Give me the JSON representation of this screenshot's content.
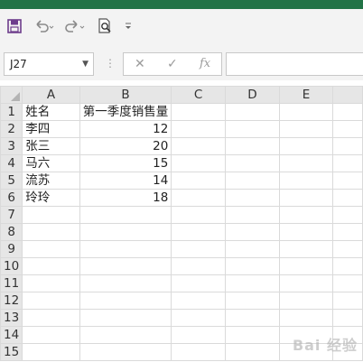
{
  "app": {
    "accent": "#217346"
  },
  "toolbar": {
    "icons": [
      "save-icon",
      "undo-icon",
      "redo-icon",
      "print-preview-icon",
      "customize-qat-icon"
    ]
  },
  "formula_bar": {
    "name_box": "J27",
    "cancel_symbol": "✕",
    "enter_symbol": "✓",
    "fx_symbol": "fx",
    "value": ""
  },
  "sheet": {
    "columns": [
      "A",
      "B",
      "C",
      "D",
      "E"
    ],
    "row_numbers": [
      "1",
      "2",
      "3",
      "4",
      "5",
      "6",
      "7",
      "8",
      "9",
      "10",
      "11",
      "12",
      "13",
      "14",
      "15"
    ],
    "cells": {
      "A1": "姓名",
      "B1": "第一季度销售量",
      "A2": "李四",
      "B2": "12",
      "A3": "张三",
      "B3": "20",
      "A4": "马六",
      "B4": "15",
      "A5": "流苏",
      "B5": "14",
      "A6": "玲玲",
      "B6": "18"
    }
  },
  "watermark": "Bai 经验"
}
